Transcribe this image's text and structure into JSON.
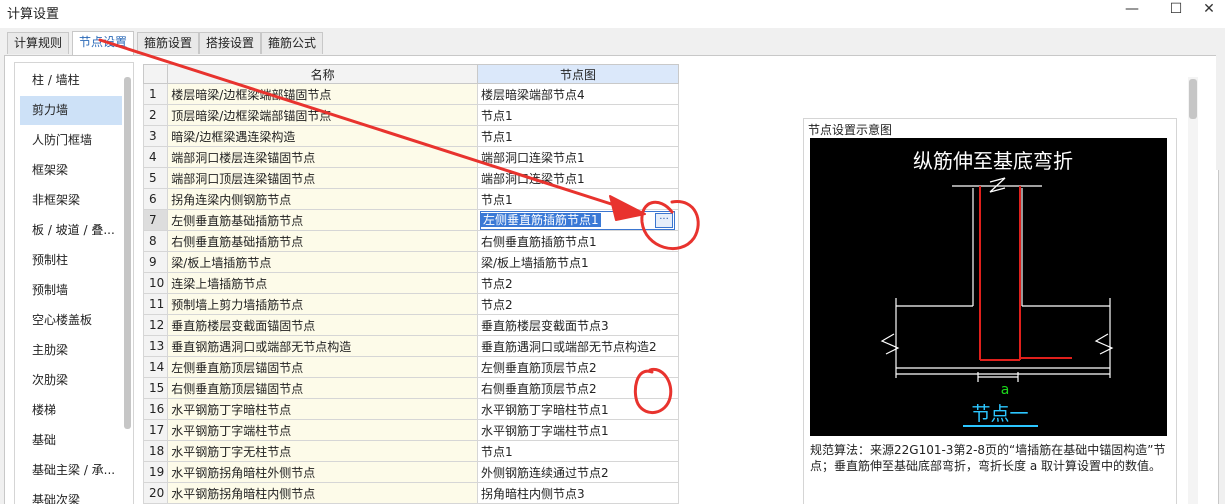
{
  "window": {
    "title": "计算设置",
    "minimize": "—",
    "maximize": "☐",
    "close": "✕"
  },
  "tabs": [
    "计算规则",
    "节点设置",
    "箍筋设置",
    "搭接设置",
    "箍筋公式"
  ],
  "active_tab": 1,
  "sidebar": {
    "items": [
      "柱 / 墙柱",
      "剪力墙",
      "人防门框墙",
      "框架梁",
      "非框架梁",
      "板 / 坡道 / 叠...",
      "预制柱",
      "预制墙",
      "空心楼盖板",
      "主肋梁",
      "次肋梁",
      "楼梯",
      "基础",
      "基础主梁 / 承...",
      "基础次梁"
    ],
    "active": 1
  },
  "table": {
    "headers": {
      "name": "名称",
      "node": "节点图"
    },
    "rows": [
      {
        "idx": "1",
        "name": "楼层暗梁/边框梁端部锚固节点",
        "node": "楼层暗梁端部节点4"
      },
      {
        "idx": "2",
        "name": "顶层暗梁/边框梁端部锚固节点",
        "node": "节点1"
      },
      {
        "idx": "3",
        "name": "暗梁/边框梁遇连梁构造",
        "node": "节点1"
      },
      {
        "idx": "4",
        "name": "端部洞口楼层连梁锚固节点",
        "node": "端部洞口连梁节点1"
      },
      {
        "idx": "5",
        "name": "端部洞口顶层连梁锚固节点",
        "node": "端部洞口连梁节点1"
      },
      {
        "idx": "6",
        "name": "拐角连梁内侧钢筋节点",
        "node": "节点1"
      },
      {
        "idx": "7",
        "name": "左侧垂直筋基础插筋节点",
        "node": "左侧垂直筋插筋节点1"
      },
      {
        "idx": "8",
        "name": "右侧垂直筋基础插筋节点",
        "node": "右侧垂直筋插筋节点1"
      },
      {
        "idx": "9",
        "name": "梁/板上墙插筋节点",
        "node": "梁/板上墙插筋节点1"
      },
      {
        "idx": "10",
        "name": "连梁上墙插筋节点",
        "node": "节点2"
      },
      {
        "idx": "11",
        "name": "预制墙上剪力墙插筋节点",
        "node": "节点2"
      },
      {
        "idx": "12",
        "name": "垂直筋楼层变截面锚固节点",
        "node": "垂直筋楼层变截面节点3"
      },
      {
        "idx": "13",
        "name": "垂直钢筋遇洞口或端部无节点构造",
        "node": "垂直筋遇洞口或端部无节点构造2"
      },
      {
        "idx": "14",
        "name": "左侧垂直筋顶层锚固节点",
        "node": "左侧垂直筋顶层节点2"
      },
      {
        "idx": "15",
        "name": "右侧垂直筋顶层锚固节点",
        "node": "右侧垂直筋顶层节点2"
      },
      {
        "idx": "16",
        "name": "水平钢筋丁字暗柱节点",
        "node": "水平钢筋丁字暗柱节点1"
      },
      {
        "idx": "17",
        "name": "水平钢筋丁字端柱节点",
        "node": "水平钢筋丁字端柱节点1"
      },
      {
        "idx": "18",
        "name": "水平钢筋丁字无柱节点",
        "node": "节点1"
      },
      {
        "idx": "19",
        "name": "水平钢筋拐角暗柱外侧节点",
        "node": "外侧钢筋连续通过节点2"
      },
      {
        "idx": "20",
        "name": "水平钢筋拐角暗柱内侧节点",
        "node": "拐角暗柱内侧节点3"
      }
    ],
    "selected_row": 7,
    "ellipsis": "···"
  },
  "preview": {
    "label": "节点设置示意图",
    "diagram_title": "纵筋伸至基底弯折",
    "dim_label": "a",
    "node_name": "节点一",
    "colors": {
      "rebar": "#e0201c",
      "dim": "#1bd81b",
      "node": "#2cc6ff",
      "line": "#ffffff"
    }
  },
  "description": "规范算法：来源22G101-3第2-8页的“墙插筋在基础中锚固构造”节点；垂直筋伸至基础底部弯折，弯折长度 a 取计算设置中的数值。",
  "annotation_color": "#e8332e"
}
